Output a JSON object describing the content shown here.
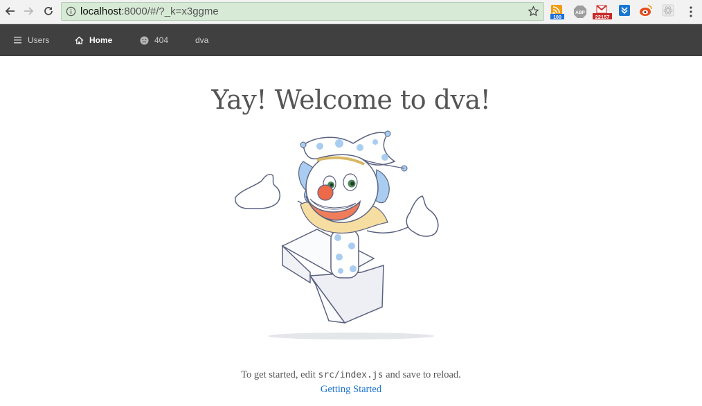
{
  "browser": {
    "url_host": "localhost",
    "url_rest": ":8000/#/?_k=x3ggme",
    "extensions": [
      {
        "name": "rss-extension-icon",
        "badge": "100",
        "color": "#f39c12",
        "badge_color": "#1e6fd9"
      },
      {
        "name": "adblock-plus-icon",
        "badge": "ABP",
        "color": "#9e9e9e"
      },
      {
        "name": "gmail-checker-icon",
        "badge": "22157",
        "color": "#d32f2f",
        "badge_color": "#c62828"
      },
      {
        "name": "pocket-download-icon",
        "color": "#1976d2"
      },
      {
        "name": "weibo-icon",
        "color": "#e64a19"
      },
      {
        "name": "react-devtools-icon",
        "color": "#cfcfcf"
      }
    ]
  },
  "nav": {
    "items": [
      {
        "label": "Users",
        "icon": "bars-icon"
      },
      {
        "label": "Home",
        "icon": "home-icon",
        "active": true
      },
      {
        "label": "404",
        "icon": "frown-icon"
      },
      {
        "label": "dva",
        "icon": ""
      }
    ]
  },
  "main": {
    "title": "Yay! Welcome to dva!",
    "footer_pre": "To get started, edit ",
    "footer_code": "src/index.js",
    "footer_post": " and save to reload.",
    "link": "Getting Started"
  },
  "colors": {
    "header_bg": "#404040",
    "omnibox_bg": "#d7ead6",
    "link": "#1f75cb"
  }
}
